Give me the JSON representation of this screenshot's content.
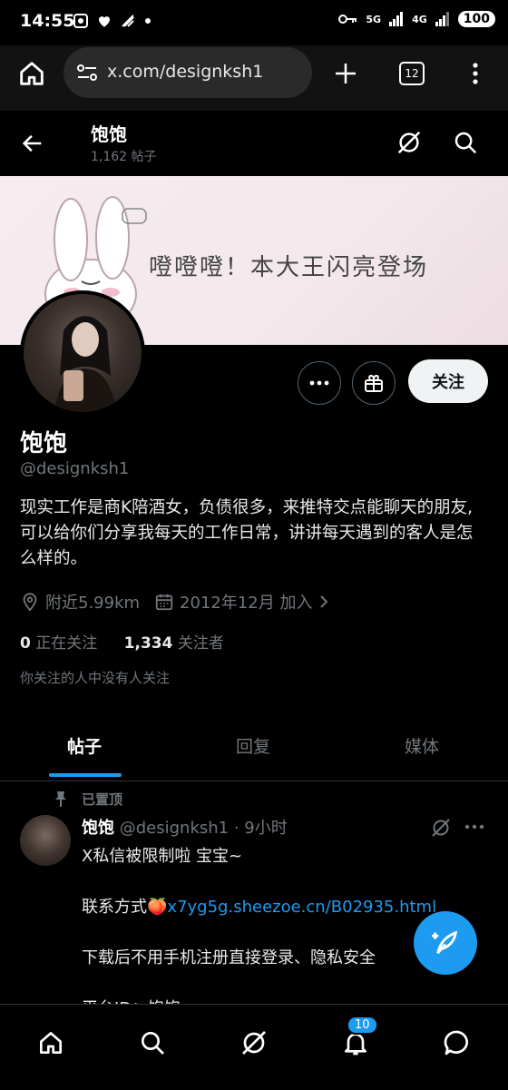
{
  "status_bar": {
    "time": "14:55",
    "network": "5G",
    "network2": "4G",
    "battery": "100"
  },
  "browser": {
    "url": "x.com/designksh1",
    "tab_count": "12"
  },
  "header": {
    "name": "饱饱",
    "post_count": "1,162 帖子"
  },
  "banner": {
    "text": "噔噔噔！本大王闪亮登场"
  },
  "profile": {
    "follow_label": "关注",
    "name": "饱饱",
    "handle": "@designksh1",
    "bio": "现实工作是商K陪酒女，负债很多，来推特交点能聊天的朋友,可以给你们分享我每天的工作日常，讲讲每天遇到的客人是怎么样的。",
    "location": "附近5.99km",
    "joined": "2012年12月 加入",
    "following_count": "0",
    "following_label": "正在关注",
    "followers_count": "1,334",
    "followers_label": "关注者",
    "known_by": "你关注的人中没有人关注"
  },
  "tabs": [
    {
      "label": "帖子",
      "active": true
    },
    {
      "label": "回复",
      "active": false
    },
    {
      "label": "媒体",
      "active": false
    }
  ],
  "post": {
    "pinned_label": "已置顶",
    "name": "饱饱",
    "handle_time": "@designksh1 · 9小时",
    "line1": "X私信被限制啦 宝宝~",
    "line2_prefix": "联系方式🍑",
    "line2_link": "x7yg5g.sheezoe.cn/B02935.html",
    "line3": "下载后不用手机注册直接登录、隐私安全",
    "line4": "平台ID：饱饱"
  },
  "bottom_nav": {
    "notification_badge": "10"
  },
  "colors": {
    "accent": "#1d9bf0",
    "background": "#000000",
    "muted": "#71767b"
  }
}
